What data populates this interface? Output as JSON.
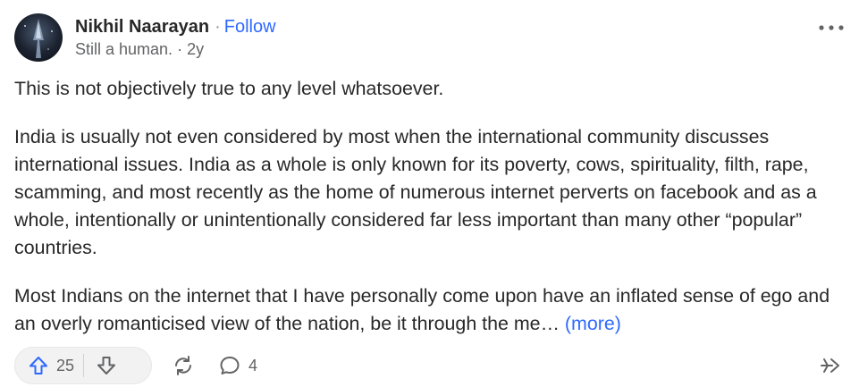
{
  "author": {
    "name": "Nikhil Naarayan",
    "separator": "·",
    "follow_label": "Follow",
    "credential": "Still a human.",
    "cred_separator": "·",
    "time": "2y"
  },
  "answer": {
    "paragraphs": [
      "This is not objectively true to any level whatsoever.",
      "India is usually not even considered by most when the international community discusses international issues. India as a whole is only known for its poverty, cows, spirituality, filth, rape, scamming, and most recently as the home of numerous internet perverts on facebook and as a whole, intentionally or unintentionally considered far less important than many other “popular” countries.",
      "Most Indians on the internet that I have personally come upon have an inflated sense of ego and an overly romanticised view of the nation, be it through the me…"
    ],
    "more_label": "(more)"
  },
  "actions": {
    "upvote_count": "25",
    "comment_count": "4"
  },
  "icons": {
    "menu": "more-horizontal-icon",
    "upvote": "upvote-arrow-icon",
    "downvote": "downvote-arrow-icon",
    "share": "share-cycle-icon",
    "comment": "comment-bubble-icon",
    "repost": "repost-icon"
  },
  "colors": {
    "link": "#2e69ff",
    "text": "#282829",
    "muted": "#636466"
  }
}
